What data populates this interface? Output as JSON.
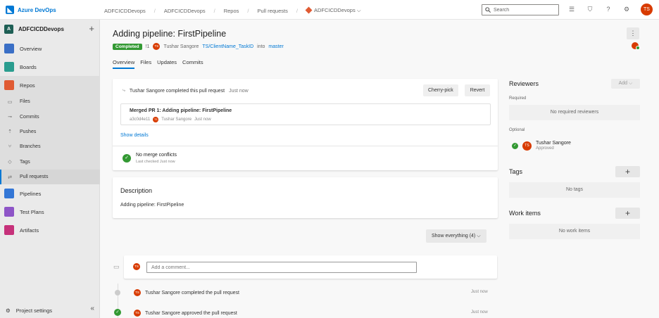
{
  "topbar": {
    "brand": "Azure DevOps",
    "breadcrumbs": [
      "ADFCICDDevops",
      "ADFCICDDevops",
      "Repos",
      "Pull requests",
      "ADFCICDDevops"
    ],
    "search_placeholder": "Search",
    "user_initials": "TS"
  },
  "sidebar": {
    "project_initial": "A",
    "project_name": "ADFCICDDevops",
    "items": {
      "overview": "Overview",
      "boards": "Boards",
      "repos": "Repos",
      "files": "Files",
      "commits": "Commits",
      "pushes": "Pushes",
      "branches": "Branches",
      "tags": "Tags",
      "pull_requests": "Pull requests",
      "pipelines": "Pipelines",
      "test_plans": "Test Plans",
      "artifacts": "Artifacts"
    },
    "settings": "Project settings"
  },
  "pr": {
    "title": "Adding pipeline: FirstPipeline",
    "status": "Completed",
    "id": "!1",
    "author_initials": "TS",
    "author": "Tushar Sangore",
    "source_branch": "TS/ClientName_TaskID",
    "into_label": "into",
    "target_branch": "master",
    "tabs": [
      "Overview",
      "Files",
      "Updates",
      "Commits"
    ]
  },
  "completion": {
    "message": "Tushar Sangore completed this pull request",
    "time": "Just now",
    "cherry_pick": "Cherry-pick",
    "revert": "Revert",
    "merge_title": "Merged PR 1: Adding pipeline: FirstPipeline",
    "merge_commit": "a3c0d4e11",
    "merge_author": "Tushar Sangore",
    "merge_time": "Just now",
    "show_details": "Show details",
    "conflicts_title": "No merge conflicts",
    "conflicts_sub": "Last checked Just now"
  },
  "description": {
    "title": "Description",
    "body": "Adding pipeline: FirstPipeline"
  },
  "activity": {
    "filter": "Show everything (4)",
    "comment_placeholder": "Add a comment...",
    "events": [
      {
        "text": "Tushar Sangore completed the pull request",
        "time": "Just now"
      },
      {
        "text": "Tushar Sangore approved the pull request",
        "time": "Just now"
      }
    ]
  },
  "right": {
    "reviewers_title": "Reviewers",
    "add_label": "Add",
    "required_label": "Required",
    "no_required": "No required reviewers",
    "optional_label": "Optional",
    "reviewer_name": "Tushar Sangore",
    "reviewer_status": "Approved",
    "tags_title": "Tags",
    "no_tags": "No tags",
    "work_items_title": "Work items",
    "no_work_items": "No work items"
  }
}
